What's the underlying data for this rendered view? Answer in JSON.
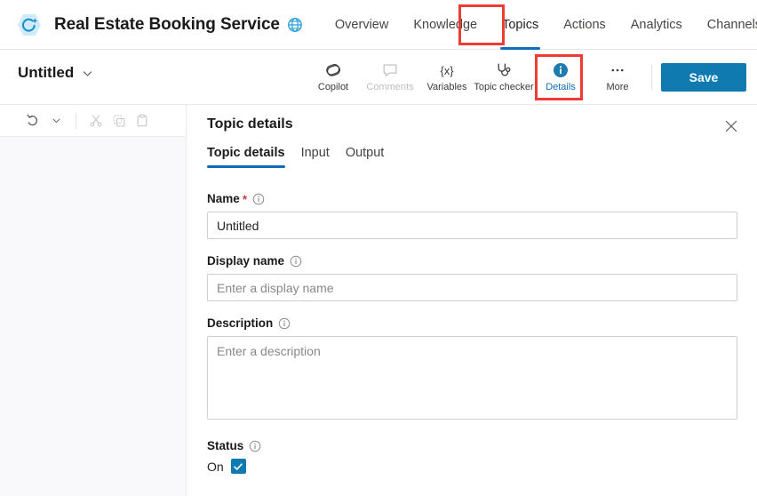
{
  "topbar": {
    "logo_icon": "copilot-hexagon-icon",
    "title": "Real Estate Booking Service",
    "globe_icon": "globe-icon",
    "tabs": [
      {
        "label": "Overview",
        "active": false
      },
      {
        "label": "Knowledge",
        "active": false
      },
      {
        "label": "Topics",
        "active": true
      },
      {
        "label": "Actions",
        "active": false
      },
      {
        "label": "Analytics",
        "active": false
      },
      {
        "label": "Channels",
        "active": false
      }
    ],
    "highlight_color": "#ee3b33",
    "active_tab_color": "#0f6cbd"
  },
  "commandbar": {
    "topic_name": "Untitled",
    "chevron_icon": "chevron-down-icon",
    "tools": [
      {
        "label": "Copilot",
        "icon": "copilot-icon",
        "state": "enabled"
      },
      {
        "label": "Comments",
        "icon": "comment-bubble-icon",
        "state": "disabled"
      },
      {
        "label": "Variables",
        "icon": "variables-braces-icon",
        "state": "enabled"
      },
      {
        "label": "Topic checker",
        "icon": "stethoscope-icon",
        "state": "enabled"
      },
      {
        "label": "Details",
        "icon": "info-circle-icon",
        "state": "selected"
      },
      {
        "label": "More",
        "icon": "ellipsis-icon",
        "state": "enabled"
      }
    ],
    "save_label": "Save",
    "save_color": "#0f7ab0"
  },
  "edit_toolbar": {
    "buttons": [
      {
        "name": "undo",
        "icon": "undo-arrow-icon",
        "state": "enabled"
      },
      {
        "name": "undo-menu",
        "icon": "chevron-down-icon",
        "state": "enabled"
      },
      {
        "name": "cut",
        "icon": "scissors-icon",
        "state": "disabled"
      },
      {
        "name": "copy",
        "icon": "copy-icon",
        "state": "disabled"
      },
      {
        "name": "paste",
        "icon": "clipboard-icon",
        "state": "disabled"
      }
    ]
  },
  "panel": {
    "title": "Topic details",
    "close_icon": "close-icon",
    "tabs": [
      {
        "label": "Topic details",
        "active": true
      },
      {
        "label": "Input",
        "active": false
      },
      {
        "label": "Output",
        "active": false
      }
    ],
    "fields": {
      "name": {
        "label": "Name",
        "required_marker": "*",
        "info_icon": "info-icon",
        "value": "Untitled",
        "placeholder": ""
      },
      "display_name": {
        "label": "Display name",
        "info_icon": "info-icon",
        "value": "",
        "placeholder": "Enter a display name"
      },
      "description": {
        "label": "Description",
        "info_icon": "info-icon",
        "value": "",
        "placeholder": "Enter a description"
      },
      "status": {
        "label": "Status",
        "info_icon": "info-icon",
        "toggle_label": "On",
        "checked": true,
        "check_icon": "checkmark-icon"
      }
    }
  }
}
